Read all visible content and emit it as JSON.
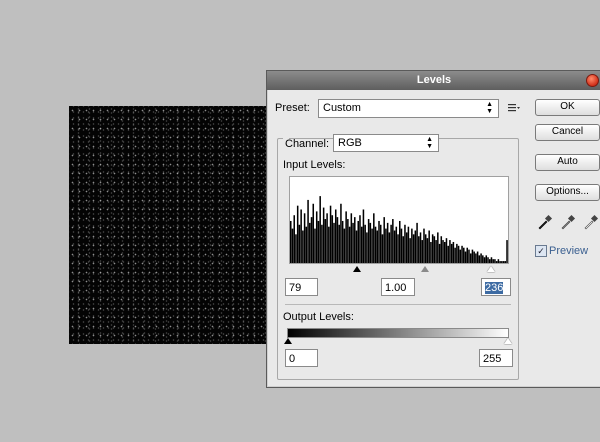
{
  "dialog": {
    "title": "Levels",
    "preset": {
      "label": "Preset:",
      "value": "Custom"
    },
    "channel": {
      "label": "Channel:",
      "value": "RGB"
    },
    "input_levels": {
      "label": "Input Levels:",
      "black": "79",
      "gamma": "1.00",
      "white": "236"
    },
    "output_levels": {
      "label": "Output Levels:",
      "black": "0",
      "white": "255"
    },
    "buttons": {
      "ok": "OK",
      "cancel": "Cancel",
      "auto": "Auto",
      "options": "Options..."
    },
    "preview": {
      "label": "Preview",
      "checked": true
    },
    "icons": [
      "preset-options-icon",
      "black-eyedropper-icon",
      "gray-eyedropper-icon",
      "white-eyedropper-icon"
    ]
  },
  "histogram": {
    "bars": [
      22,
      18,
      25,
      15,
      30,
      20,
      28,
      17,
      26,
      19,
      33,
      21,
      24,
      31,
      18,
      27,
      22,
      35,
      20,
      29,
      23,
      26,
      19,
      30,
      25,
      21,
      28,
      24,
      20,
      31,
      22,
      18,
      27,
      23,
      19,
      26,
      21,
      24,
      17,
      22,
      25,
      19,
      28,
      20,
      16,
      23,
      21,
      18,
      26,
      19,
      17,
      22,
      20,
      15,
      24,
      18,
      21,
      16,
      20,
      23,
      17,
      19,
      15,
      22,
      18,
      14,
      20,
      16,
      19,
      13,
      18,
      15,
      17,
      21,
      14,
      16,
      12,
      18,
      15,
      13,
      17,
      11,
      15,
      14,
      12,
      16,
      10,
      14,
      12,
      11,
      13,
      9,
      12,
      10,
      11,
      8,
      10,
      9,
      7,
      9,
      8,
      6,
      8,
      7,
      5,
      7,
      6,
      5,
      6,
      4,
      5,
      4,
      3,
      4,
      3,
      2,
      3,
      2,
      2,
      1,
      2,
      1,
      1,
      1,
      1,
      12
    ]
  }
}
